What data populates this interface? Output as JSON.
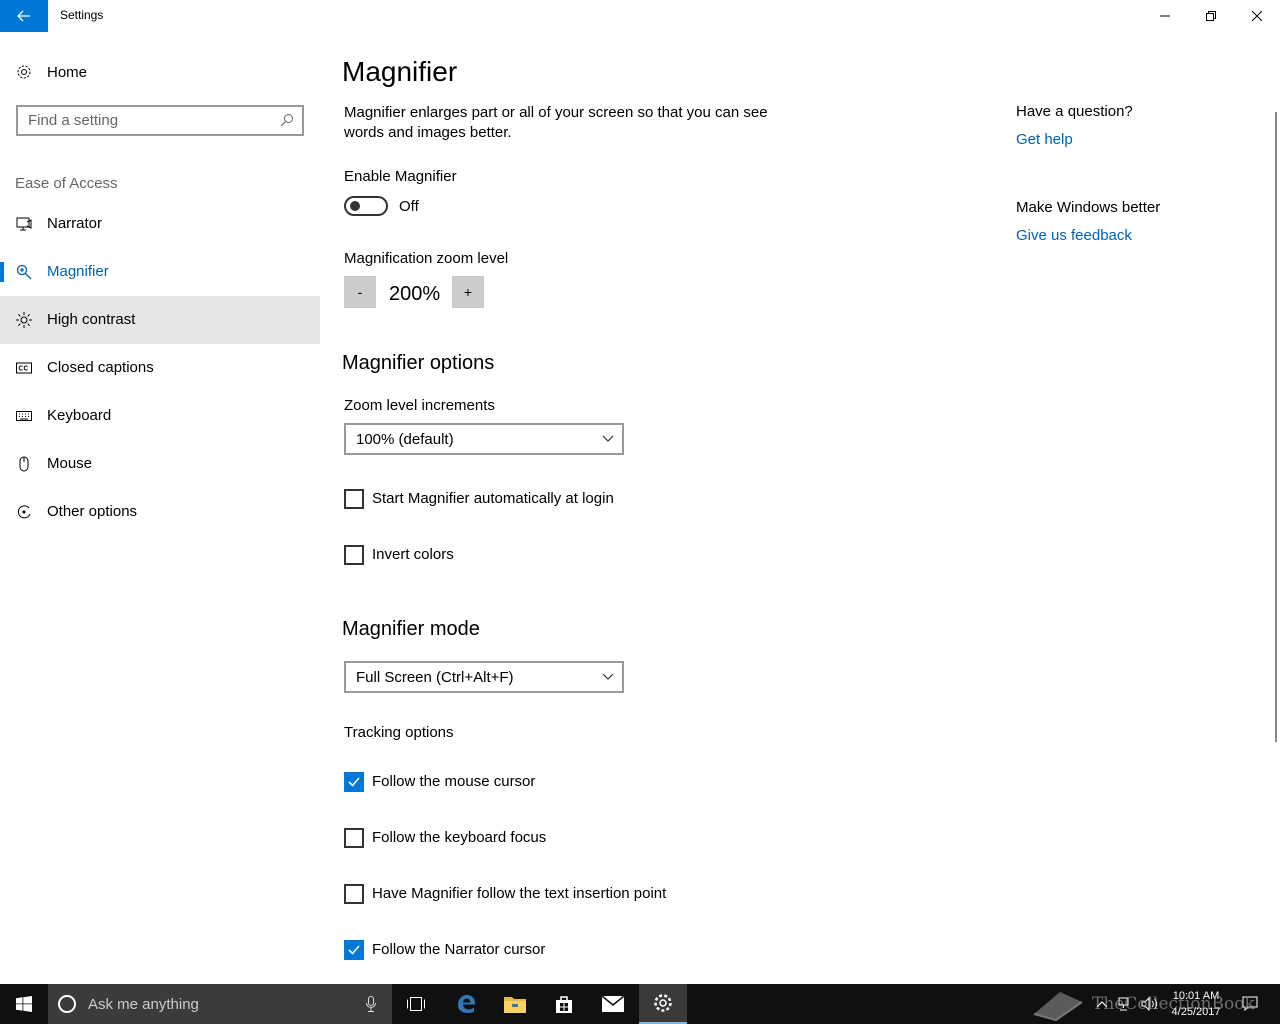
{
  "window": {
    "title": "Settings"
  },
  "sidebar": {
    "home_label": "Home",
    "search_placeholder": "Find a setting",
    "section_label": "Ease of Access",
    "items": [
      {
        "label": "Narrator",
        "icon": "narrator-icon"
      },
      {
        "label": "Magnifier",
        "icon": "magnifier-icon",
        "selected": true
      },
      {
        "label": "High contrast",
        "icon": "high-contrast-icon",
        "hover": true
      },
      {
        "label": "Closed captions",
        "icon": "closed-captions-icon"
      },
      {
        "label": "Keyboard",
        "icon": "keyboard-icon"
      },
      {
        "label": "Mouse",
        "icon": "mouse-icon"
      },
      {
        "label": "Other options",
        "icon": "other-options-icon"
      }
    ]
  },
  "main": {
    "title": "Magnifier",
    "description": "Magnifier enlarges part or all of your screen so that you can see words and images better.",
    "enable_label": "Enable Magnifier",
    "enable_state": "Off",
    "zoom_label": "Magnification zoom level",
    "zoom_minus": "-",
    "zoom_value": "200%",
    "zoom_plus": "+",
    "options_title": "Magnifier options",
    "increments_label": "Zoom level increments",
    "increments_value": "100% (default)",
    "start_auto_label": "Start Magnifier automatically at login",
    "invert_label": "Invert colors",
    "mode_title": "Magnifier mode",
    "mode_value": "Full Screen (Ctrl+Alt+F)",
    "tracking_label": "Tracking options",
    "tracking": [
      {
        "label": "Follow the mouse cursor",
        "checked": true
      },
      {
        "label": "Follow the keyboard focus",
        "checked": false
      },
      {
        "label": "Have Magnifier follow the text insertion point",
        "checked": false
      },
      {
        "label": "Follow the Narrator cursor",
        "checked": true
      }
    ]
  },
  "right_pane": {
    "question_heading": "Have a question?",
    "help_link": "Get help",
    "feedback_heading": "Make Windows better",
    "feedback_link": "Give us feedback"
  },
  "taskbar": {
    "search_placeholder": "Ask me anything",
    "time": "10:01 AM",
    "date": "4/25/2017",
    "watermark": "TheCollectionBook"
  },
  "colors": {
    "accent": "#0078d7",
    "link": "#0063b1",
    "taskbar": "#101010"
  }
}
